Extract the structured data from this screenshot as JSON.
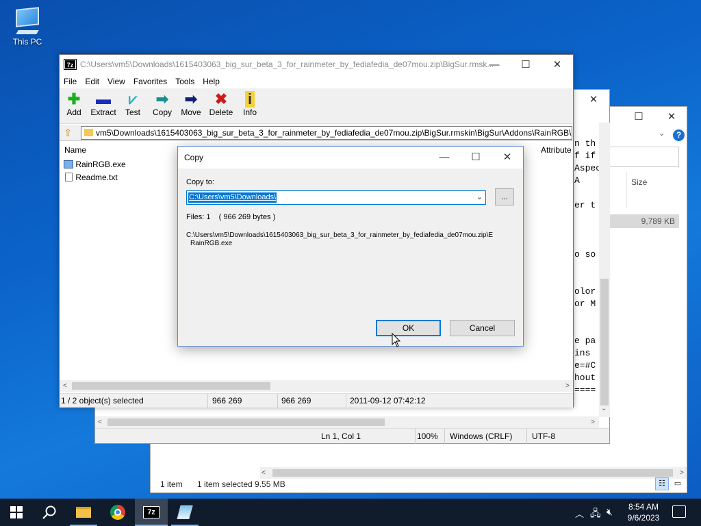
{
  "desktop": {
    "this_pc_label": "This PC"
  },
  "explorer": {
    "column_size": "Size",
    "row_size": "9,789 KB",
    "status_count": "1 item",
    "status_selected": "1 item selected  9.55 MB"
  },
  "notepad": {
    "code_lines": [
      "n th",
      "f if",
      "Aspec",
      "A",
      "",
      "er t",
      "",
      "",
      "",
      "o so",
      "",
      "",
      "olor",
      "or M",
      "",
      "",
      "e pa",
      "ins",
      "e=#C",
      "hout",
      "===="
    ],
    "status_pos": "Ln 1, Col 1",
    "status_zoom": "100%",
    "status_eol": "Windows (CRLF)",
    "status_enc": "UTF-8"
  },
  "zip": {
    "title": "C:\\Users\\vm5\\Downloads\\1615403063_big_sur_beta_3_for_rainmeter_by_fediafedia_de07mou.zip\\BigSur.rmsk...",
    "menu": [
      "File",
      "Edit",
      "View",
      "Favorites",
      "Tools",
      "Help"
    ],
    "toolbar": {
      "add": "Add",
      "extract": "Extract",
      "test": "Test",
      "copy": "Copy",
      "move": "Move",
      "delete": "Delete",
      "info": "Info"
    },
    "address": "vm5\\Downloads\\1615403063_big_sur_beta_3_for_rainmeter_by_fediafedia_de07mou.zip\\BigSur.rmskin\\BigSur\\Addons\\RainRGB\\",
    "col_name": "Name",
    "col_attributes": "Attribute",
    "files": [
      {
        "name": "RainRGB.exe",
        "icon": "exe-icon"
      },
      {
        "name": "Readme.txt",
        "icon": "txt-icon"
      }
    ],
    "status_selected": "1 / 2 object(s) selected",
    "status_size": "966 269",
    "status_packed": "966 269",
    "status_modified": "2011-09-12 07:42:12"
  },
  "dialog": {
    "title": "Copy",
    "copy_to_label": "Copy to:",
    "path_value": "C:\\Users\\vm5\\Downloads\\",
    "browse_label": "...",
    "files_info": "Files: 1    ( 966 269 bytes )",
    "source_path": "C:\\Users\\vm5\\Downloads\\1615403063_big_sur_beta_3_for_rainmeter_by_fediafedia_de07mou.zip\\E",
    "source_file": "RainRGB.exe",
    "ok_label": "OK",
    "cancel_label": "Cancel"
  },
  "taskbar": {
    "time": "8:54 AM",
    "date": "9/6/2023",
    "app_7zip_label": "7z"
  },
  "colors": {
    "accent": "#0078d7",
    "taskbar": "#101b2c",
    "selection": "#0078d7"
  }
}
